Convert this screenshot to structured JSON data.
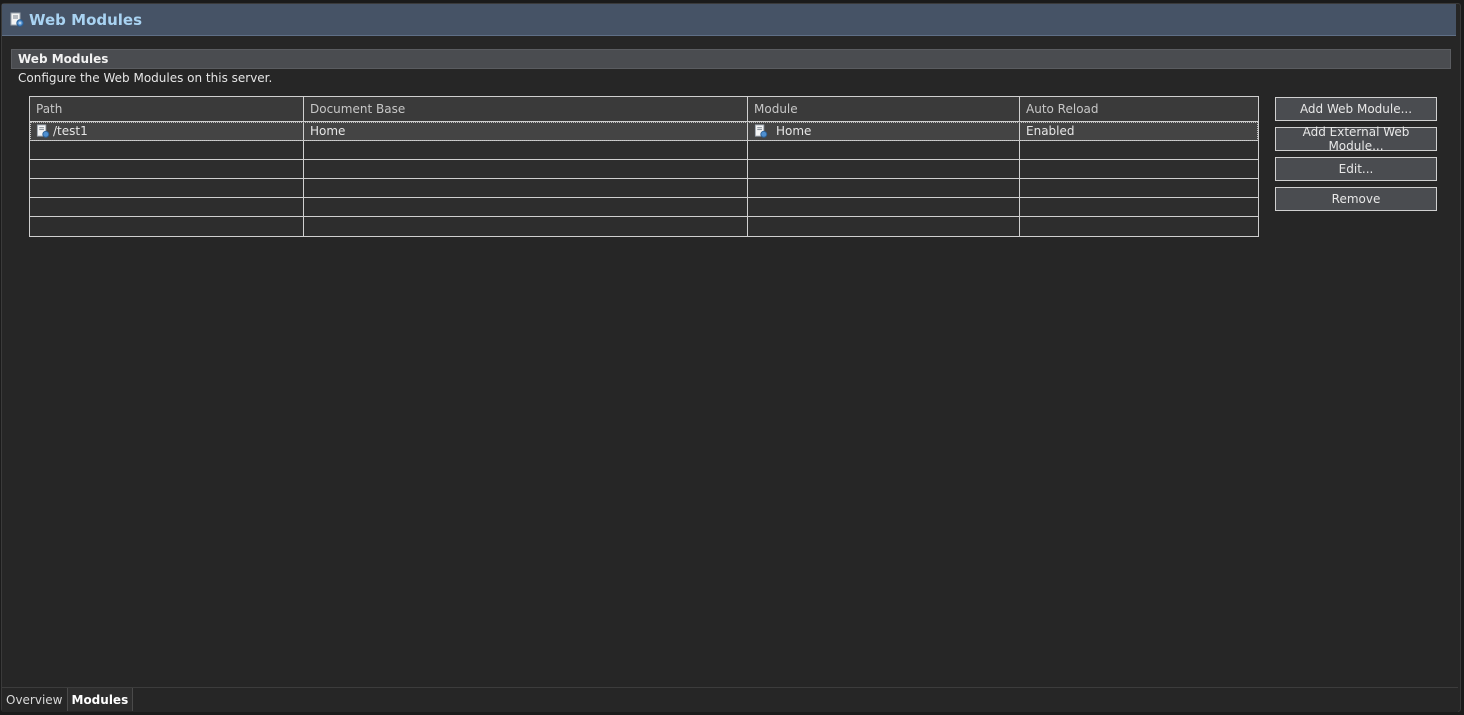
{
  "page": {
    "title": "Web Modules",
    "title_icon": "web-module-icon"
  },
  "section": {
    "header": "Web Modules",
    "description": "Configure the Web Modules on this server."
  },
  "table": {
    "columns": [
      "Path",
      "Document Base",
      "Module",
      "Auto Reload"
    ],
    "rows": [
      {
        "path": "/test1",
        "path_icon": "web-module-icon",
        "document_base": "Home",
        "module": "Home",
        "module_icon": "web-module-icon",
        "auto_reload": "Enabled",
        "selected": true
      }
    ],
    "empty_rows": 5
  },
  "buttons": {
    "add_web_module": "Add Web Module...",
    "add_external_web_module": "Add External Web Module...",
    "edit": "Edit...",
    "remove": "Remove"
  },
  "tabs": [
    {
      "label": "Overview",
      "active": false
    },
    {
      "label": "Modules",
      "active": true
    }
  ],
  "colors": {
    "title_bar": "#465366",
    "title_text": "#a9d3f2",
    "background": "#262626"
  }
}
